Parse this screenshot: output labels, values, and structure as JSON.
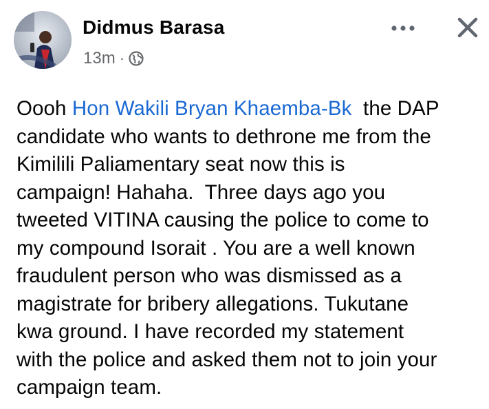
{
  "post": {
    "author_name": "Didmus Barasa",
    "timestamp": "13m",
    "separator": "·",
    "privacy_icon": "globe-icon",
    "more_icon": "more-dots-icon",
    "close_icon": "close-icon",
    "colors": {
      "text": "#050505",
      "meta": "#65676b",
      "link": "#1968d4"
    },
    "body": {
      "line1_before": "Oooh ",
      "mention": "Hon Wakili Bryan Khaemba-Bk",
      "line1_after": "  the DAP",
      "line2": "candidate who wants to dethrone me from the",
      "line3": "Kimilili Paliamentary seat now this is",
      "line4": "campaign! Hahaha.  Three days ago you",
      "line5": "tweeted VITINA causing the police to come to",
      "line6": "my compound Isorait . You are a well known",
      "line7": "fraudulent person who was dismissed as a",
      "line8": "magistrate for bribery allegations. Tukutane",
      "line9": "kwa ground. I have recorded my statement",
      "line10": "with the police and asked them not to join your",
      "line11": "campaign team."
    }
  }
}
